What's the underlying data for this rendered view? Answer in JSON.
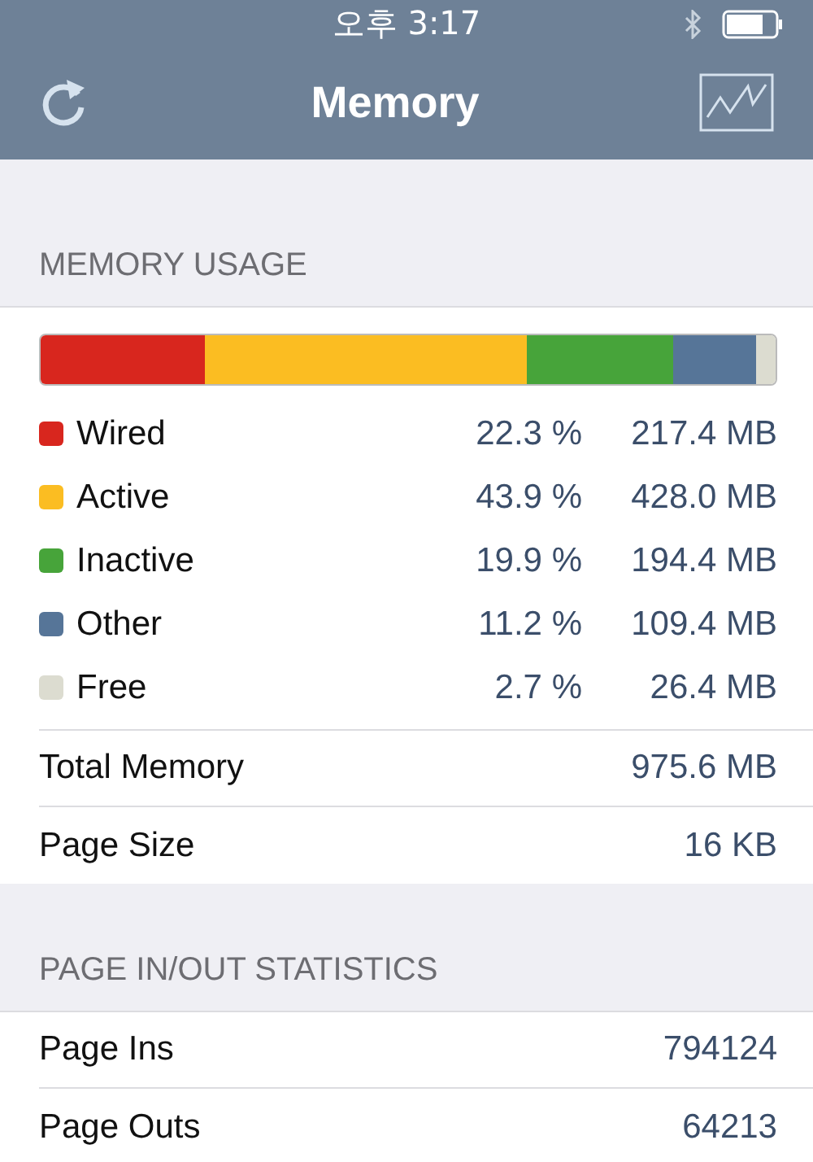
{
  "status_bar": {
    "time": "오후 3:17"
  },
  "nav": {
    "title": "Memory"
  },
  "sections": [
    {
      "header": "MEMORY USAGE",
      "breakdown": [
        {
          "name": "Wired",
          "percent": "22.3 %",
          "amount": "217.4 MB",
          "color": "#d8261e"
        },
        {
          "name": "Active",
          "percent": "43.9 %",
          "amount": "428.0 MB",
          "color": "#fbbd22"
        },
        {
          "name": "Inactive",
          "percent": "19.9 %",
          "amount": "194.4 MB",
          "color": "#47a43a"
        },
        {
          "name": "Other",
          "percent": "11.2 %",
          "amount": "109.4 MB",
          "color": "#567598"
        },
        {
          "name": "Free",
          "percent": "2.7 %",
          "amount": "26.4 MB",
          "color": "#dcdcd0"
        }
      ],
      "rows": [
        {
          "label": "Total Memory",
          "value": "975.6 MB"
        },
        {
          "label": "Page Size",
          "value": "16 KB"
        }
      ]
    },
    {
      "header": "PAGE IN/OUT STATISTICS",
      "rows": [
        {
          "label": "Page Ins",
          "value": "794124"
        },
        {
          "label": "Page Outs",
          "value": "64213"
        }
      ]
    }
  ]
}
